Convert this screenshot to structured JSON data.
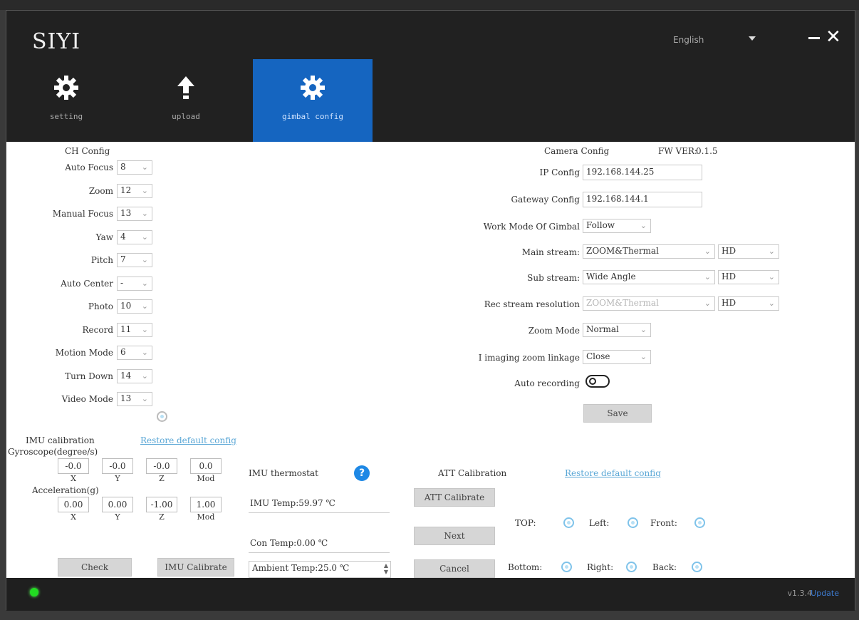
{
  "app": {
    "brand": "SIYI",
    "language": "English",
    "version": "v1.3.4",
    "version_link": "Update"
  },
  "nav": [
    {
      "label": "setting",
      "icon": "gear-icon"
    },
    {
      "label": "upload",
      "icon": "upload-arrow-icon"
    },
    {
      "label": "gimbal config",
      "icon": "gear-icon",
      "active": true
    }
  ],
  "ch_config": {
    "title": "CH Config",
    "rows": [
      {
        "label": "Auto Focus",
        "value": "8"
      },
      {
        "label": "Zoom",
        "value": "12"
      },
      {
        "label": "Manual Focus",
        "value": "13"
      },
      {
        "label": "Yaw",
        "value": "4"
      },
      {
        "label": "Pitch",
        "value": "7"
      },
      {
        "label": "Auto Center",
        "value": "-"
      },
      {
        "label": "Photo",
        "value": "10"
      },
      {
        "label": "Record",
        "value": "11"
      },
      {
        "label": "Motion Mode",
        "value": "6"
      },
      {
        "label": "Turn Down",
        "value": "14"
      },
      {
        "label": "Video Mode",
        "value": "13"
      }
    ]
  },
  "camera_config": {
    "title": "Camera Config",
    "fw_label": "FW VER:",
    "fw_value": "0.1.5",
    "ip_label": "IP Config",
    "ip_value": "192.168.144.25",
    "gateway_label": "Gateway Config",
    "gateway_value": "192.168.144.1",
    "work_mode_label": "Work Mode Of Gimbal",
    "work_mode_value": "Follow",
    "main_stream_label": "Main stream:",
    "main_stream_value": "ZOOM&Thermal",
    "main_stream_res": "HD",
    "sub_stream_label": "Sub stream:",
    "sub_stream_value": "Wide Angle",
    "sub_stream_res": "HD",
    "rec_stream_label": "Rec stream resolution",
    "rec_stream_value": "ZOOM&Thermal",
    "rec_stream_res": "HD",
    "zoom_mode_label": "Zoom Mode",
    "zoom_mode_value": "Normal",
    "imaging_label": "I imaging zoom linkage",
    "imaging_value": "Close",
    "auto_rec_label": "Auto recording",
    "save_label": "Save"
  },
  "imu": {
    "title": "IMU calibration",
    "restore_link": "Restore default config",
    "gyro_label": "Gyroscope(degree/s)",
    "gyro_values": [
      "-0.0",
      "-0.0",
      "-0.0",
      "0.0"
    ],
    "accel_label": "Acceleration(g)",
    "accel_values": [
      "0.00",
      "0.00",
      "-1.00",
      "1.00"
    ],
    "axes": [
      "X",
      "Y",
      "Z",
      "Mod"
    ],
    "check_label": "Check",
    "calibrate_label": "IMU Calibrate"
  },
  "thermostat": {
    "title": "IMU thermostat",
    "imu_temp": "IMU Temp:59.97 ℃",
    "con_temp": "Con Temp:0.00 ℃",
    "ambient_temp": "Ambient Temp:25.0 ℃"
  },
  "att": {
    "title": "ATT Calibration",
    "restore_link": "Restore default config",
    "calibrate_label": "ATT Calibrate",
    "next_label": "Next",
    "cancel_label": "Cancel",
    "top_label": "TOP:",
    "left_label": "Left:",
    "front_label": "Front:",
    "bottom_label": "Bottom:",
    "right_label": "Right:",
    "back_label": "Back:"
  }
}
